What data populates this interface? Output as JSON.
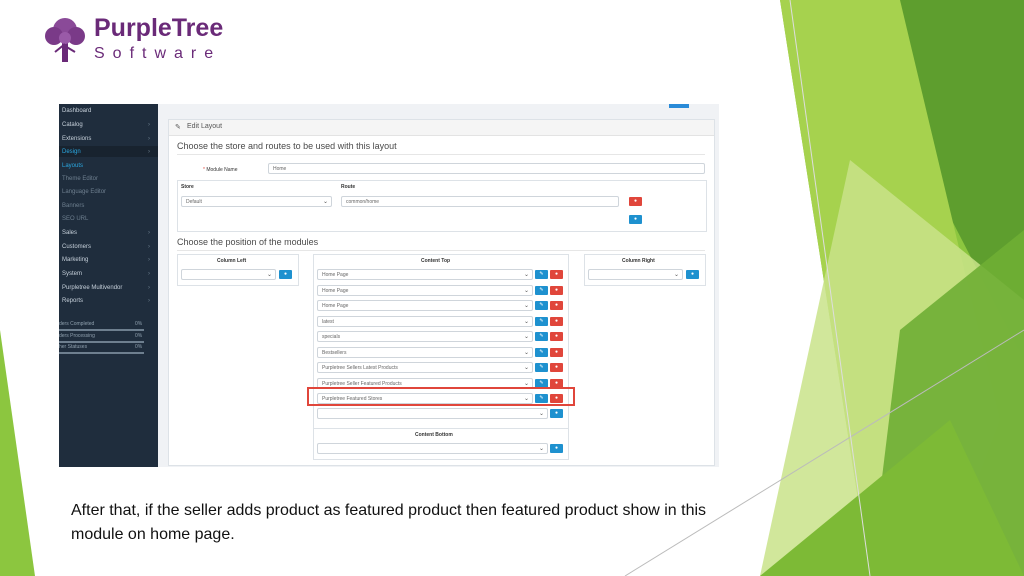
{
  "logo": {
    "name": "PurpleTree",
    "sub": "Software"
  },
  "sidebar": {
    "items": [
      {
        "label": "Dashboard",
        "caret": ""
      },
      {
        "label": "Catalog",
        "caret": "›"
      },
      {
        "label": "Extensions",
        "caret": "›"
      },
      {
        "label": "Design",
        "caret": "›"
      },
      {
        "label": "Layouts",
        "caret": ""
      },
      {
        "label": "Theme Editor",
        "caret": ""
      },
      {
        "label": "Language Editor",
        "caret": ""
      },
      {
        "label": "Banners",
        "caret": ""
      },
      {
        "label": "SEO URL",
        "caret": ""
      },
      {
        "label": "Sales",
        "caret": "›"
      },
      {
        "label": "Customers",
        "caret": "›"
      },
      {
        "label": "Marketing",
        "caret": "›"
      },
      {
        "label": "System",
        "caret": "›"
      },
      {
        "label": "Purpletree Multivendor",
        "caret": "›"
      },
      {
        "label": "Reports",
        "caret": "›"
      }
    ],
    "stats": [
      {
        "label": "ders Completed",
        "value": "0%"
      },
      {
        "label": "ders Processing",
        "value": "0%"
      },
      {
        "label": "her Statuses",
        "value": "0%"
      }
    ]
  },
  "panel": {
    "title": "Edit Layout",
    "heading_routes": "Choose the store and routes to be used with this layout",
    "module_name_label": "Module Name",
    "module_name_value": "Home",
    "store_header": "Store",
    "route_header": "Route",
    "store_value": "Default",
    "route_value": "common/home",
    "heading_positions": "Choose the position of the modules",
    "column_left": "Column Left",
    "content_top": "Content Top",
    "column_right": "Column Right",
    "content_bottom": "Content Bottom",
    "content_top_modules": [
      "Home Page",
      "Home Page",
      "Home Page",
      "latest",
      "specials",
      "Bestsellers",
      "Purpletree Sellers Latest Products",
      "Purpletree Seller Featured Products",
      "Purpletree Featured Stores"
    ]
  },
  "caption": "After that, if the seller adds product as featured product then featured product show in this module on home page.",
  "colors": {
    "brand_purple": "#6a2a78",
    "sidebar_bg": "#1f2d3d",
    "button_blue": "#1e91cf",
    "button_red": "#e0463b",
    "green_light": "#b6d765",
    "green_dark": "#5c9a2c"
  },
  "icons": {
    "edit": "pencil-icon",
    "remove": "minus-circle-icon",
    "add": "plus-circle-icon",
    "dropdown": "chevron-down-icon"
  }
}
